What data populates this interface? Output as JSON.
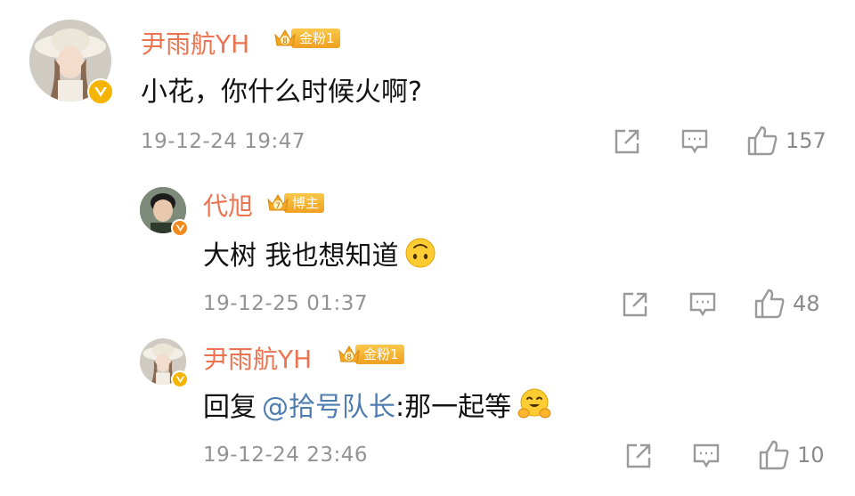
{
  "comments": [
    {
      "username": "尹雨航YH",
      "badge": "金粉1",
      "badge_level": "8",
      "text": "小花，你什么时候火啊?",
      "time": "19-12-24 19:47",
      "likes": "157"
    },
    {
      "username": "代旭",
      "badge": "博主",
      "badge_level": "7",
      "text": "大树 我也想知道",
      "emoji": "upside-down-face",
      "time": "19-12-25 01:37",
      "likes": "48"
    },
    {
      "username": "尹雨航YH",
      "badge": "金粉1",
      "badge_level": "8",
      "text_prefix": "回复",
      "mention": "@拾号队长",
      "text_suffix": ":那一起等",
      "emoji": "hugging-face",
      "time": "19-12-24 23:46",
      "likes": "10"
    }
  ],
  "icons": {
    "share": "share-icon",
    "comment": "comment-icon",
    "like": "thumbs-up-icon",
    "verified": "verified-v-icon",
    "crown": "crown-icon"
  },
  "colors": {
    "username": "#eb7350",
    "mention": "#507daf",
    "meta": "#939393",
    "badge_gold": "#f0a020",
    "verified_yellow": "#f5b400",
    "verified_orange": "#f08a1c"
  }
}
